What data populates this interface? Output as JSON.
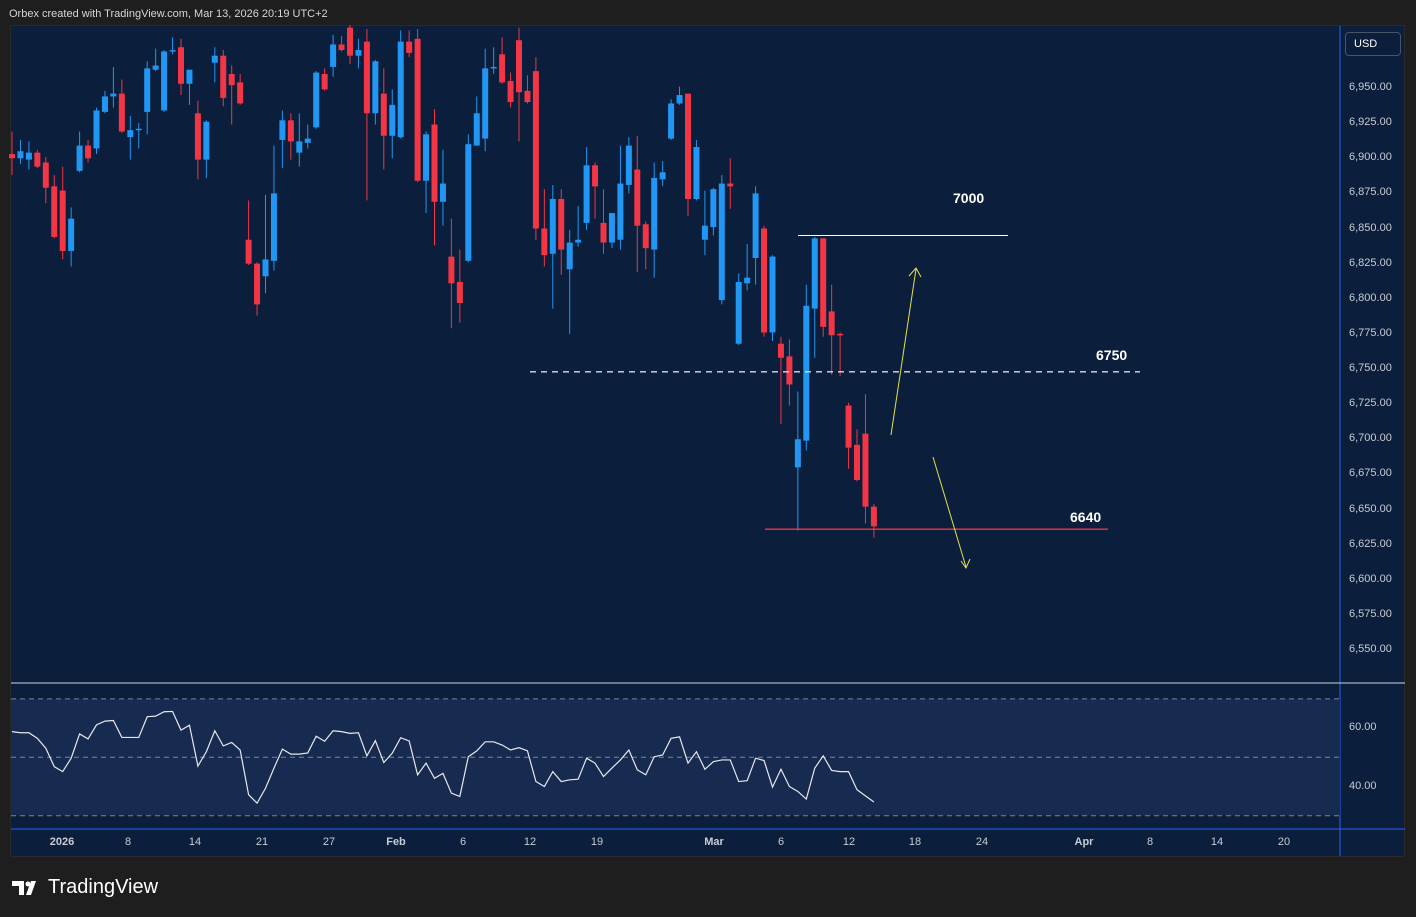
{
  "header": {
    "caption": "Orbex created with TradingView.com, Mar 13, 2026 20:19 UTC+2"
  },
  "currency_button": "USD",
  "price_axis": [
    "6,950.00",
    "6,925.00",
    "6,900.00",
    "6,875.00",
    "6,850.00",
    "6,825.00",
    "6,800.00",
    "6,775.00",
    "6,750.00",
    "6,725.00",
    "6,700.00",
    "6,675.00",
    "6,650.00",
    "6,625.00",
    "6,600.00",
    "6,575.00",
    "6,550.00"
  ],
  "rsi_axis": [
    "60.00",
    "40.00"
  ],
  "time_axis": [
    "2026",
    "8",
    "14",
    "21",
    "27",
    "Feb",
    "6",
    "12",
    "19",
    "Mar",
    "6",
    "12",
    "18",
    "24",
    "Apr",
    "8",
    "14",
    "20"
  ],
  "levels": {
    "resistance_label": "7000",
    "mid_label": "6750",
    "support_label": "6640",
    "resistance_price": 6845,
    "mid_price": 6748,
    "support_price": 6636
  },
  "colors": {
    "up": "#2196f3",
    "down": "#f23645",
    "background": "#0b1e3b",
    "rsi_band": "#172a4f",
    "arrow": "#e6e04a"
  },
  "logo": "TradingView",
  "chart_data": {
    "type": "candlestick",
    "ylim": [
      6525,
      7000
    ],
    "columns": [
      "open",
      "high",
      "low",
      "close"
    ],
    "ohlc": [
      [
        6903,
        6919,
        6888,
        6900
      ],
      [
        6900,
        6913,
        6896,
        6905
      ],
      [
        6899,
        6912,
        6892,
        6904
      ],
      [
        6904,
        6906,
        6893,
        6894
      ],
      [
        6897,
        6901,
        6868,
        6879
      ],
      [
        6880,
        6888,
        6843,
        6844
      ],
      [
        6877,
        6894,
        6828,
        6834
      ],
      [
        6834,
        6865,
        6823,
        6857
      ],
      [
        6891,
        6919,
        6890,
        6909
      ],
      [
        6909,
        6913,
        6897,
        6900
      ],
      [
        6907,
        6936,
        6903,
        6934
      ],
      [
        6933,
        6948,
        6932,
        6944
      ],
      [
        6944,
        6965,
        6936,
        6946
      ],
      [
        6946,
        6956,
        6918,
        6919
      ],
      [
        6915,
        6930,
        6899,
        6920
      ],
      [
        6920,
        6925,
        6907,
        6921
      ],
      [
        6933,
        6969,
        6917,
        6964
      ],
      [
        6963,
        6978,
        6962,
        6966
      ],
      [
        6934,
        6977,
        6933,
        6976
      ],
      [
        6976,
        6986,
        6974,
        6977
      ],
      [
        6979,
        6985,
        6945,
        6953
      ],
      [
        6953,
        6963,
        6938,
        6963
      ],
      [
        6932,
        6941,
        6885,
        6899
      ],
      [
        6899,
        6927,
        6886,
        6926
      ],
      [
        6968,
        6979,
        6954,
        6973
      ],
      [
        6973,
        6977,
        6937,
        6943
      ],
      [
        6960,
        6966,
        6924,
        6952
      ],
      [
        6954,
        6960,
        6938,
        6939
      ],
      [
        6842,
        6870,
        6824,
        6825
      ],
      [
        6825,
        6826,
        6788,
        6796
      ],
      [
        6816,
        6874,
        6804,
        6828
      ],
      [
        6827,
        6909,
        6820,
        6875
      ],
      [
        6913,
        6934,
        6893,
        6927
      ],
      [
        6927,
        6932,
        6899,
        6912
      ],
      [
        6904,
        6932,
        6894,
        6912
      ],
      [
        6911,
        6924,
        6907,
        6914
      ],
      [
        6922,
        6962,
        6921,
        6961
      ],
      [
        6960,
        6964,
        6948,
        6949
      ],
      [
        6965,
        6988,
        6958,
        6981
      ],
      [
        6981,
        6987,
        6976,
        6977
      ],
      [
        6993,
        6995,
        6967,
        6973
      ],
      [
        6973,
        6985,
        6964,
        6977
      ],
      [
        6983,
        6992,
        6870,
        6932
      ],
      [
        6932,
        6970,
        6924,
        6969
      ],
      [
        6946,
        6964,
        6892,
        6916
      ],
      [
        6916,
        6949,
        6900,
        6938
      ],
      [
        6915,
        6991,
        6914,
        6983
      ],
      [
        6983,
        6991,
        6972,
        6975
      ],
      [
        6985,
        6992,
        6883,
        6884
      ],
      [
        6884,
        6919,
        6861,
        6917
      ],
      [
        6924,
        6935,
        6838,
        6869
      ],
      [
        6869,
        6906,
        6852,
        6882
      ],
      [
        6830,
        6857,
        6779,
        6811
      ],
      [
        6812,
        6835,
        6783,
        6797
      ],
      [
        6827,
        6917,
        6826,
        6910
      ],
      [
        6909,
        6944,
        6909,
        6932
      ],
      [
        6914,
        6978,
        6905,
        6964
      ],
      [
        6964,
        6979,
        6960,
        6965
      ],
      [
        6974,
        6986,
        6953,
        6954
      ],
      [
        6955,
        6961,
        6936,
        6940
      ],
      [
        6984,
        6993,
        6912,
        6947
      ],
      [
        6948,
        6959,
        6939,
        6940
      ],
      [
        6962,
        6972,
        6842,
        6850
      ],
      [
        6850,
        6878,
        6823,
        6831
      ],
      [
        6832,
        6881,
        6793,
        6871
      ],
      [
        6871,
        6878,
        6817,
        6835
      ],
      [
        6821,
        6849,
        6775,
        6840
      ],
      [
        6840,
        6866,
        6837,
        6842
      ],
      [
        6854,
        6908,
        6849,
        6895
      ],
      [
        6895,
        6897,
        6857,
        6880
      ],
      [
        6854,
        6878,
        6832,
        6840
      ],
      [
        6840,
        6861,
        6836,
        6861
      ],
      [
        6842,
        6909,
        6835,
        6882
      ],
      [
        6881,
        6915,
        6875,
        6909
      ],
      [
        6892,
        6916,
        6819,
        6852
      ],
      [
        6853,
        6855,
        6821,
        6836
      ],
      [
        6835,
        6897,
        6815,
        6886
      ],
      [
        6885,
        6898,
        6880,
        6890
      ],
      [
        6914,
        6942,
        6913,
        6939
      ],
      [
        6939,
        6951,
        6938,
        6945
      ],
      [
        6946,
        6946,
        6859,
        6871
      ],
      [
        6871,
        6913,
        6870,
        6908
      ],
      [
        6842,
        6877,
        6831,
        6852
      ],
      [
        6851,
        6879,
        6845,
        6878
      ],
      [
        6799,
        6888,
        6796,
        6882
      ],
      [
        6882,
        6900,
        6864,
        6880
      ],
      [
        6768,
        6818,
        6767,
        6812
      ],
      [
        6811,
        6839,
        6806,
        6815
      ],
      [
        6829,
        6880,
        6810,
        6875
      ],
      [
        6850,
        6852,
        6773,
        6776
      ],
      [
        6776,
        6831,
        6770,
        6830
      ],
      [
        6768,
        6773,
        6711,
        6758
      ],
      [
        6759,
        6771,
        6724,
        6739
      ],
      [
        6680,
        6734,
        6635,
        6700
      ],
      [
        6699,
        6810,
        6692,
        6795
      ],
      [
        6793,
        6844,
        6758,
        6843
      ],
      [
        6843,
        6843,
        6773,
        6780
      ],
      [
        6791,
        6810,
        6746,
        6774
      ],
      [
        6775,
        6776,
        6745,
        6774
      ],
      [
        6724,
        6726,
        6679,
        6694
      ],
      [
        6696,
        6707,
        6670,
        6671
      ],
      [
        6704,
        6732,
        6640,
        6652
      ],
      [
        6652,
        6654,
        6630,
        6638
      ]
    ],
    "rsi": {
      "bands": [
        70,
        50,
        30
      ],
      "values": [
        58.8,
        58.4,
        58.4,
        56.5,
        53.1,
        46.8,
        45.1,
        49.7,
        58.0,
        56.3,
        61.1,
        62.4,
        62.6,
        56.8,
        56.8,
        56.8,
        63.9,
        64.1,
        65.6,
        65.7,
        59.3,
        61.0,
        47.0,
        51.9,
        59.1,
        53.9,
        55.1,
        52.5,
        37.2,
        34.3,
        39.4,
        46.3,
        52.8,
        51.1,
        51.1,
        51.5,
        57.2,
        55.5,
        59.1,
        58.8,
        58.2,
        58.4,
        50.5,
        55.7,
        48.2,
        51.4,
        56.7,
        55.6,
        44.0,
        48.0,
        42.8,
        44.5,
        37.7,
        36.6,
        50.2,
        52.2,
        55.3,
        55.3,
        54.2,
        52.5,
        53.3,
        52.2,
        41.7,
        40.0,
        45.1,
        41.7,
        42.3,
        42.5,
        49.7,
        48.0,
        43.4,
        46.3,
        49.1,
        52.5,
        45.7,
        44.0,
        50.2,
        50.8,
        56.5,
        57.0,
        48.0,
        51.9,
        45.9,
        48.5,
        49.1,
        49.1,
        41.7,
        42.0,
        49.7,
        48.9,
        39.8,
        45.9,
        40.0,
        38.3,
        35.7,
        46.3,
        50.5,
        45.5,
        45.1,
        45.1,
        38.9,
        36.8,
        34.7
      ]
    }
  }
}
